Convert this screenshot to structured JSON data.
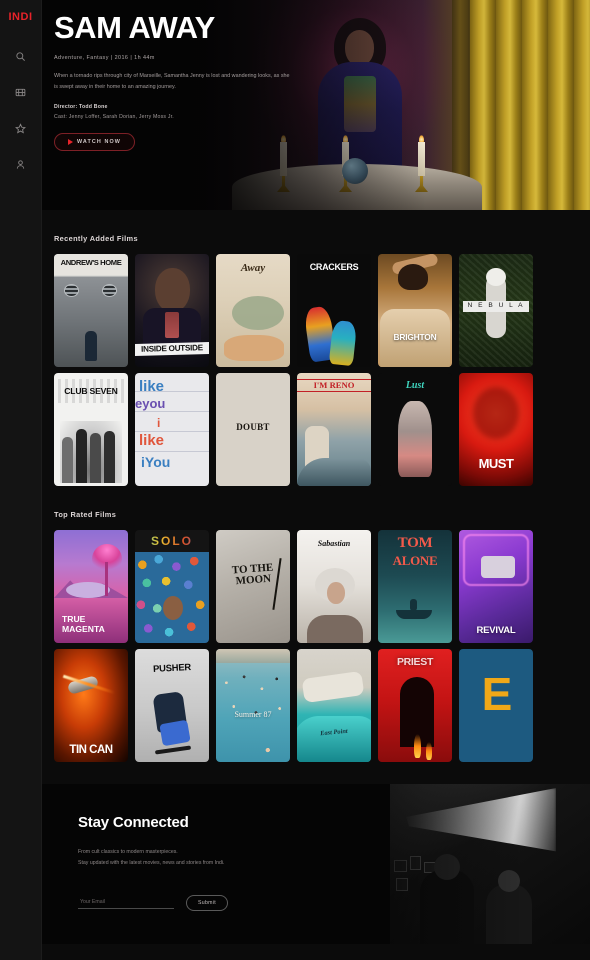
{
  "sidebar": {
    "logo": "INDI",
    "items": [
      {
        "name": "search-icon",
        "label": "Search"
      },
      {
        "name": "films-icon",
        "label": "Films"
      },
      {
        "name": "star-icon",
        "label": "Favorites"
      },
      {
        "name": "user-icon",
        "label": "Account"
      }
    ]
  },
  "hero": {
    "title": "SAM AWAY",
    "meta": "Adventure, Fantasy  |  2016  |  1h 44m",
    "description": "When a tornado rips through city of Marseille, Samantha Jenny is lost and wandering looks, as she is swept away in their home to an amazing journey.",
    "director": "Director: Todd Bone",
    "cast": "Cast: Jenny Loffer, Sarah Dorian, Jerry Moss Jr.",
    "watch_label": "WATCH NOW"
  },
  "sections": [
    {
      "title": "Recently Added Films",
      "films": [
        {
          "title": "ANDREW'S HOME",
          "art": "p-andrews"
        },
        {
          "title": "INSIDE OUTSIDE",
          "art": "p-inside"
        },
        {
          "title": "Away",
          "art": "p-away"
        },
        {
          "title": "CRACKERS",
          "art": "p-crackers"
        },
        {
          "title": "BRIGHTON",
          "art": "p-brighton"
        },
        {
          "title": "N E B U L A",
          "art": "p-nebula"
        },
        {
          "title": "CLUB SEVEN",
          "art": "p-club"
        },
        {
          "title": "i like you",
          "art": "p-like"
        },
        {
          "title": "DOUBT",
          "art": "p-doubt"
        },
        {
          "title": "I'M RENO",
          "art": "p-reno"
        },
        {
          "title": "Lust",
          "art": "p-lust"
        },
        {
          "title": "MUST",
          "art": "p-must"
        }
      ]
    },
    {
      "title": "Top Rated Films",
      "films": [
        {
          "title": "TRUE MAGENTA",
          "art": "p-magenta"
        },
        {
          "title": "SOLO",
          "art": "p-solo"
        },
        {
          "title": "TO THE MOON",
          "art": "p-moon"
        },
        {
          "title": "Sabastian",
          "art": "p-sab"
        },
        {
          "title": "TOM ALONE",
          "art": "p-tom"
        },
        {
          "title": "REVIVAL",
          "art": "p-revival"
        },
        {
          "title": "TIN CAN",
          "art": "p-tincan"
        },
        {
          "title": "PUSHER",
          "art": "p-pusher"
        },
        {
          "title": "Summer 87",
          "art": "p-summer"
        },
        {
          "title": "East Point",
          "art": "p-east"
        },
        {
          "title": "PRIEST",
          "art": "p-priest"
        },
        {
          "title": "E",
          "art": "p-e"
        }
      ]
    }
  ],
  "poster_text": {
    "andrews": "ANDREW'S HOME",
    "inside": "INSIDE OUTSIDE",
    "away": "Away",
    "crackers": "CRACKERS",
    "brighton": "BRIGHTON",
    "nebula": "N E B U L A",
    "club": "CLUB SEVEN",
    "like1": "like",
    "like2": "eyou",
    "like3": "i",
    "like4": "like",
    "like5": "iYou",
    "doubt": "DOUBT",
    "reno": "I'M RENO",
    "lust": "Lust",
    "must": "MUST",
    "magenta": "TRUE MAGENTA",
    "solo": "SOLO",
    "moon": "TO THE MOON",
    "sab": "Sabastian",
    "tom1": "TOM",
    "tom2": "ALONE",
    "revival": "REVIVAL",
    "tincan": "TIN CAN",
    "pusher": "PUSHER",
    "summer": "Summer 87",
    "east": "East Point",
    "priest": "PRIEST",
    "e": "E"
  },
  "footer": {
    "title": "Stay Connected",
    "line1": "From cult classics to modern masterpieces.",
    "line2": "Stay updated with the latest movies, news and stories from Indi.",
    "email_placeholder": "Your Email",
    "submit_label": "Submit"
  },
  "colors": {
    "accent": "#e8232a",
    "background": "#0b0b0b",
    "sidebar": "#141414",
    "text": "#ffffff",
    "muted": "#a49d9d"
  }
}
